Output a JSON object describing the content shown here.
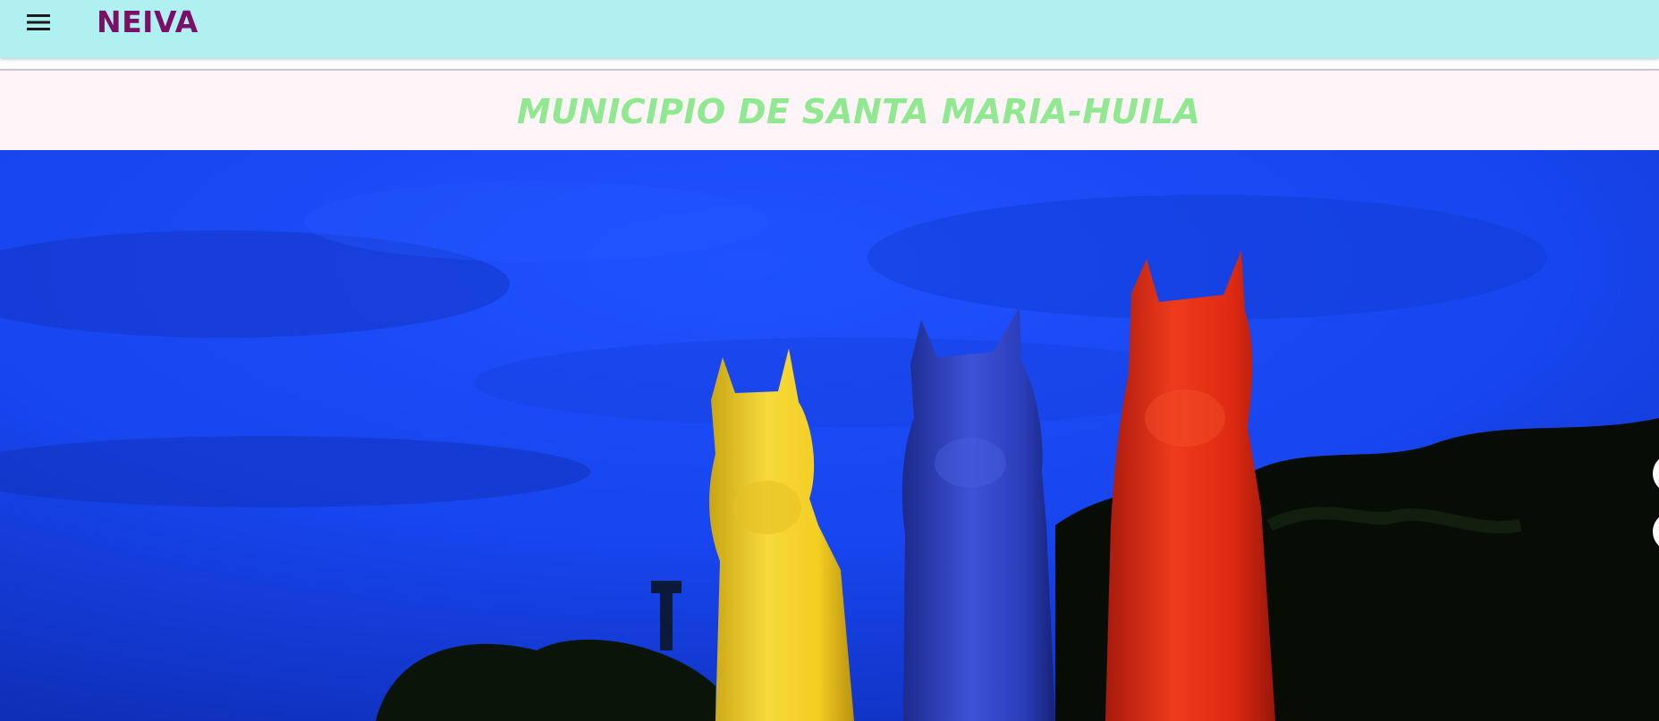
{
  "header": {
    "menu_icon": "hamburger-menu-icon",
    "brand": "NEIVA",
    "background_color": "#aff0f0",
    "brand_color": "#7b0f66"
  },
  "main": {
    "title": "MUNICIPIO DE SANTA MARIA-HUILA",
    "title_color": "#90e890",
    "band_color": "#fff5f9"
  },
  "hero": {
    "image_subject": "three horse statues (yellow, blue, red) against a blue evening sky",
    "statue_colors": [
      "#f2cc1e",
      "#2b3fc4",
      "#e02a14"
    ],
    "sky_color": "#1844f0"
  },
  "carousel": {
    "controls": [
      "carousel-next-icon",
      "carousel-next-icon"
    ]
  }
}
